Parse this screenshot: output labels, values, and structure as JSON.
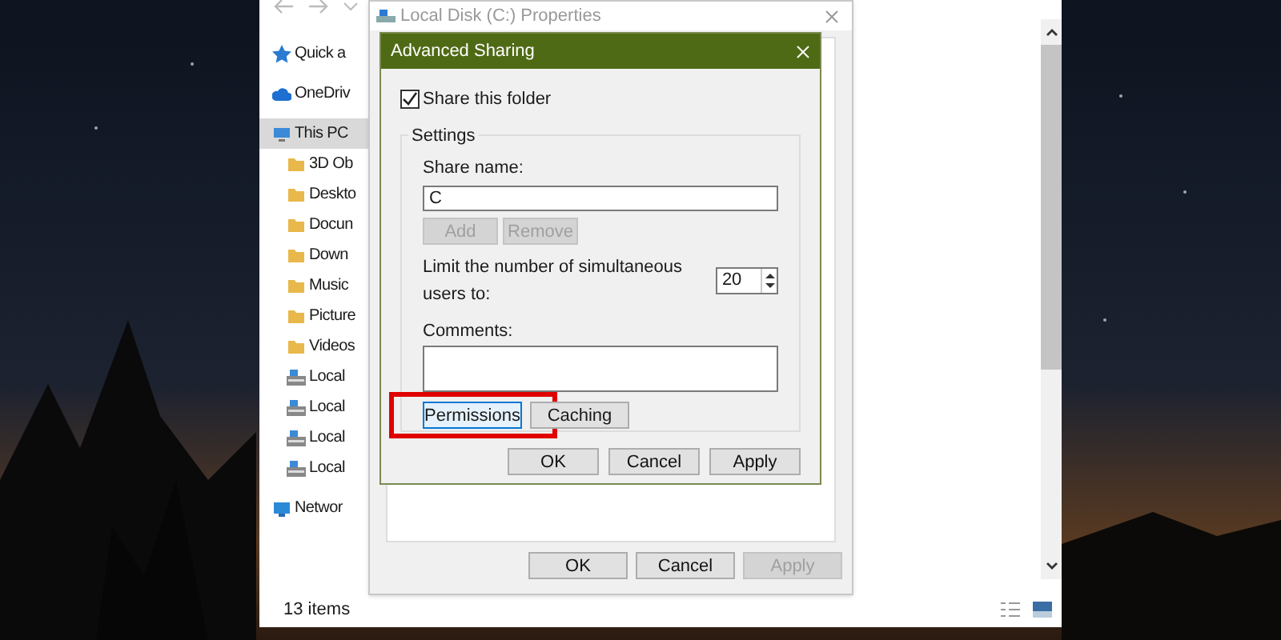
{
  "explorer": {
    "sidebar": {
      "items": [
        {
          "label": "Quick a",
          "kind": "star",
          "selected": false
        },
        {
          "label": "OneDriv",
          "kind": "cloud",
          "selected": false
        },
        {
          "label": "This PC",
          "kind": "pc",
          "selected": true
        },
        {
          "label": "3D Ob",
          "kind": "folder",
          "selected": false
        },
        {
          "label": "Deskto",
          "kind": "folder",
          "selected": false
        },
        {
          "label": "Docun",
          "kind": "folder",
          "selected": false
        },
        {
          "label": "Down",
          "kind": "folder",
          "selected": false
        },
        {
          "label": "Music",
          "kind": "folder",
          "selected": false
        },
        {
          "label": "Picture",
          "kind": "folder",
          "selected": false
        },
        {
          "label": "Videos",
          "kind": "folder",
          "selected": false
        },
        {
          "label": "Local",
          "kind": "drive",
          "selected": false
        },
        {
          "label": "Local",
          "kind": "drive",
          "selected": false
        },
        {
          "label": "Local",
          "kind": "drive",
          "selected": false
        },
        {
          "label": "Local",
          "kind": "drive",
          "selected": false
        },
        {
          "label": "Networ",
          "kind": "network",
          "selected": false
        }
      ]
    },
    "status_bar": "13 items"
  },
  "properties": {
    "title": "Local Disk (C:) Properties",
    "buttons": [
      {
        "label": "OK",
        "disabled": false
      },
      {
        "label": "Cancel",
        "disabled": false
      },
      {
        "label": "Apply",
        "disabled": true
      }
    ]
  },
  "advanced_sharing": {
    "title": "Advanced Sharing",
    "share_checkbox": {
      "label": "Share this folder",
      "checked": true
    },
    "group_label": "Settings",
    "share_name": {
      "label": "Share name:",
      "value": "C"
    },
    "user_buttons": [
      {
        "label": "Add",
        "disabled": true
      },
      {
        "label": "Remove",
        "disabled": true
      }
    ],
    "user_limit": {
      "label": "Limit the number of simultaneous users to:",
      "value": "20"
    },
    "comments": {
      "label": "Comments:"
    },
    "option_buttons": [
      {
        "label": "Permissions",
        "focused": true,
        "highlighted": true
      },
      {
        "label": "Caching",
        "focused": false,
        "highlighted": false
      }
    ],
    "buttons": [
      {
        "label": "OK",
        "disabled": false
      },
      {
        "label": "Cancel",
        "disabled": false
      },
      {
        "label": "Apply",
        "disabled": false
      }
    ]
  }
}
